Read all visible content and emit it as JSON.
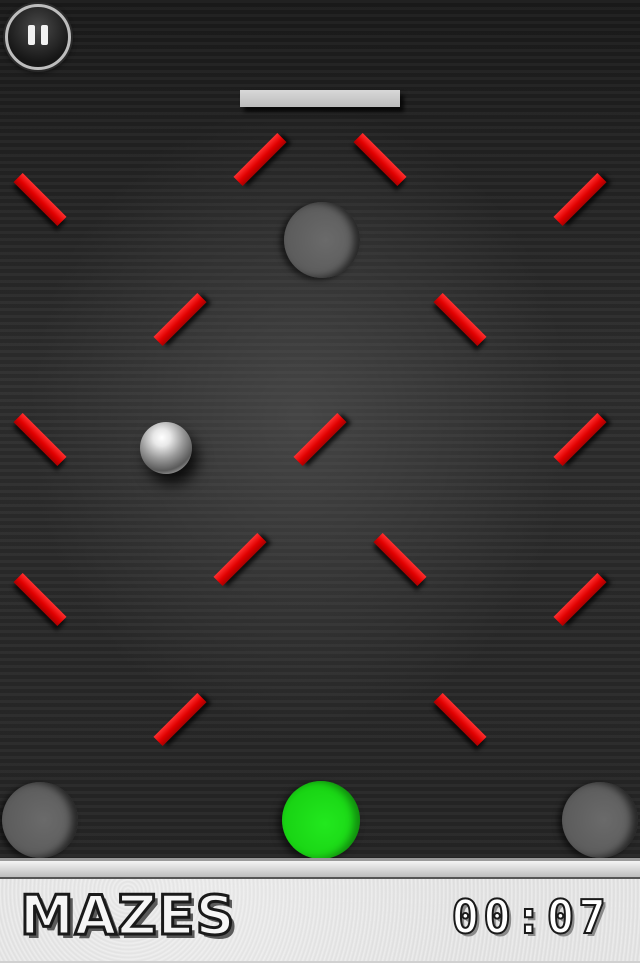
{
  "game": {
    "level_name": "MAZES",
    "timer": "00:07",
    "pause_icon": "pause-icon",
    "colors": {
      "peg": "#e10000",
      "goal": "#19d414",
      "hole": "#5c5c5c",
      "gate": "#cfcfcf",
      "background": "#2a2a2a"
    }
  }
}
